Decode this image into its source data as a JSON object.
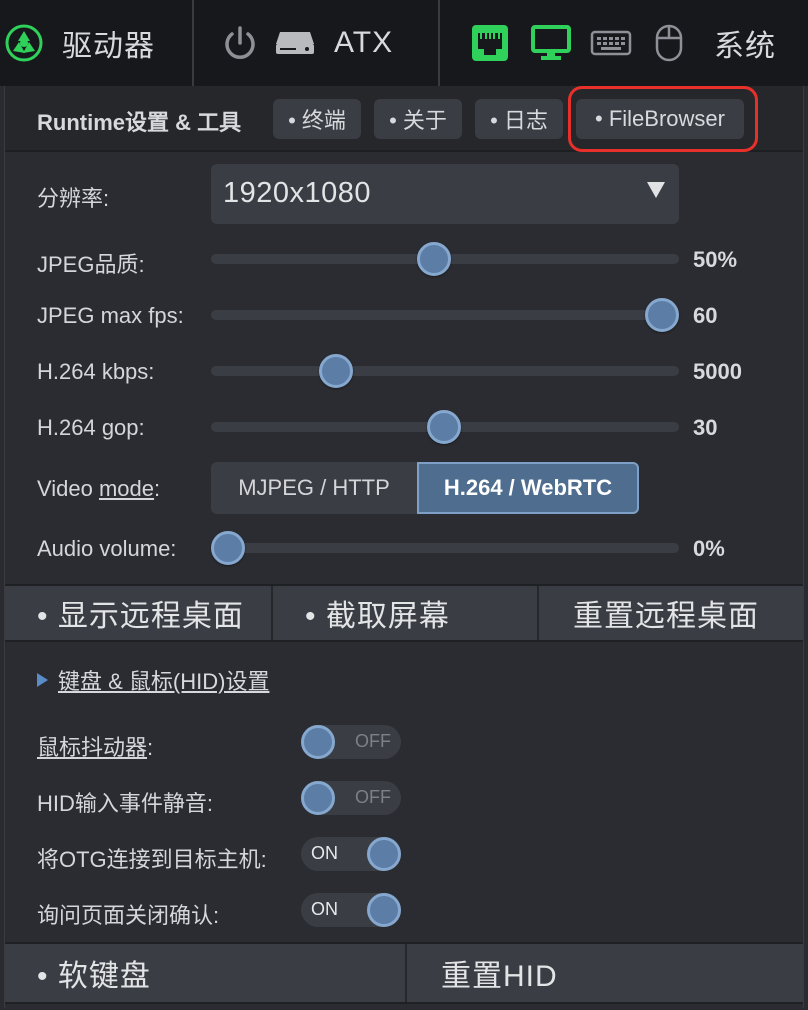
{
  "topbar": {
    "drive_label": "驱动器",
    "atx_label": "ATX",
    "system_label": "系统",
    "icons": [
      "drive-logo-icon",
      "power-icon",
      "server-icon",
      "network-icon",
      "monitor-icon",
      "keyboard-icon",
      "mouse-icon"
    ],
    "colors": {
      "active_green": "#2fd15a"
    }
  },
  "panel": {
    "title": "Runtime设置 & 工具",
    "tabs": [
      "• 终端",
      "• 关于",
      "• 日志",
      "• FileBrowser"
    ],
    "resolution": {
      "label": "分辨率:",
      "value": "1920x1080"
    },
    "sliders": [
      {
        "label": "JPEG品质:",
        "value": "50%",
        "fraction": 0.477
      },
      {
        "label": "JPEG max fps:",
        "value": "60",
        "fraction": 0.963
      },
      {
        "label": "H.264 kbps:",
        "value": "5000",
        "fraction": 0.267
      },
      {
        "label": "H.264 gop:",
        "value": "30",
        "fraction": 0.498
      },
      {
        "label": "Audio volume:",
        "value": "0%",
        "fraction": 0.036
      }
    ],
    "video_mode": {
      "label_pre": "Video ",
      "label_link": "mode",
      "label_post": ":",
      "options": [
        "MJPEG / HTTP",
        "H.264 / WebRTC"
      ],
      "selected": "H.264 / WebRTC"
    },
    "actions": [
      "• 显示远程桌面",
      "• 截取屏幕",
      "重置远程桌面"
    ],
    "hid": {
      "heading": "键盘 & 鼠标(HID)设置",
      "toggles": [
        {
          "label_link": "鼠标抖动器",
          "label_post": ":",
          "state": "OFF"
        },
        {
          "label": "HID输入事件静音:",
          "state": "OFF"
        },
        {
          "label": "将OTG连接到目标主机:",
          "state": "ON"
        },
        {
          "label": "询问页面关闭确认:",
          "state": "ON"
        }
      ]
    },
    "bottom_actions": [
      "• 软键盘",
      "重置HID"
    ]
  }
}
